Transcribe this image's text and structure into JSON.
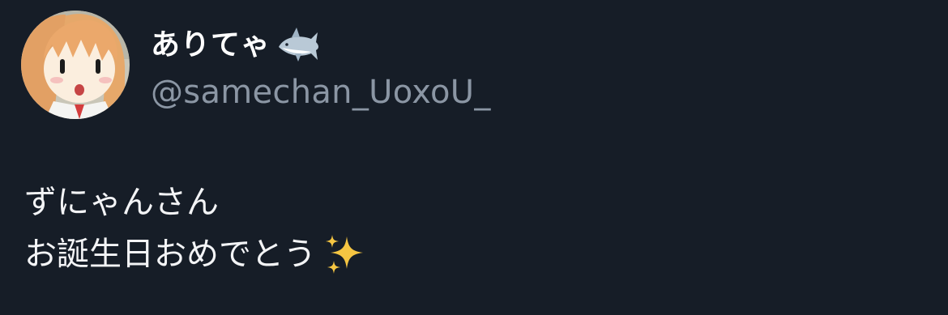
{
  "tweet": {
    "author": {
      "display_name": "ありてゃ",
      "name_emoji": "shark-icon",
      "handle": "@samechan_UoxoU_",
      "avatar": "anime-girl-avatar"
    },
    "text": {
      "line1": "ずにゃんさん",
      "line2": "お誕生日おめでとう",
      "line2_emoji": "sparkles-icon"
    }
  },
  "colors": {
    "background": "#161d27",
    "text_primary": "#ffffff",
    "text_secondary": "#8b96a4",
    "sparkle": "#f5c542"
  }
}
